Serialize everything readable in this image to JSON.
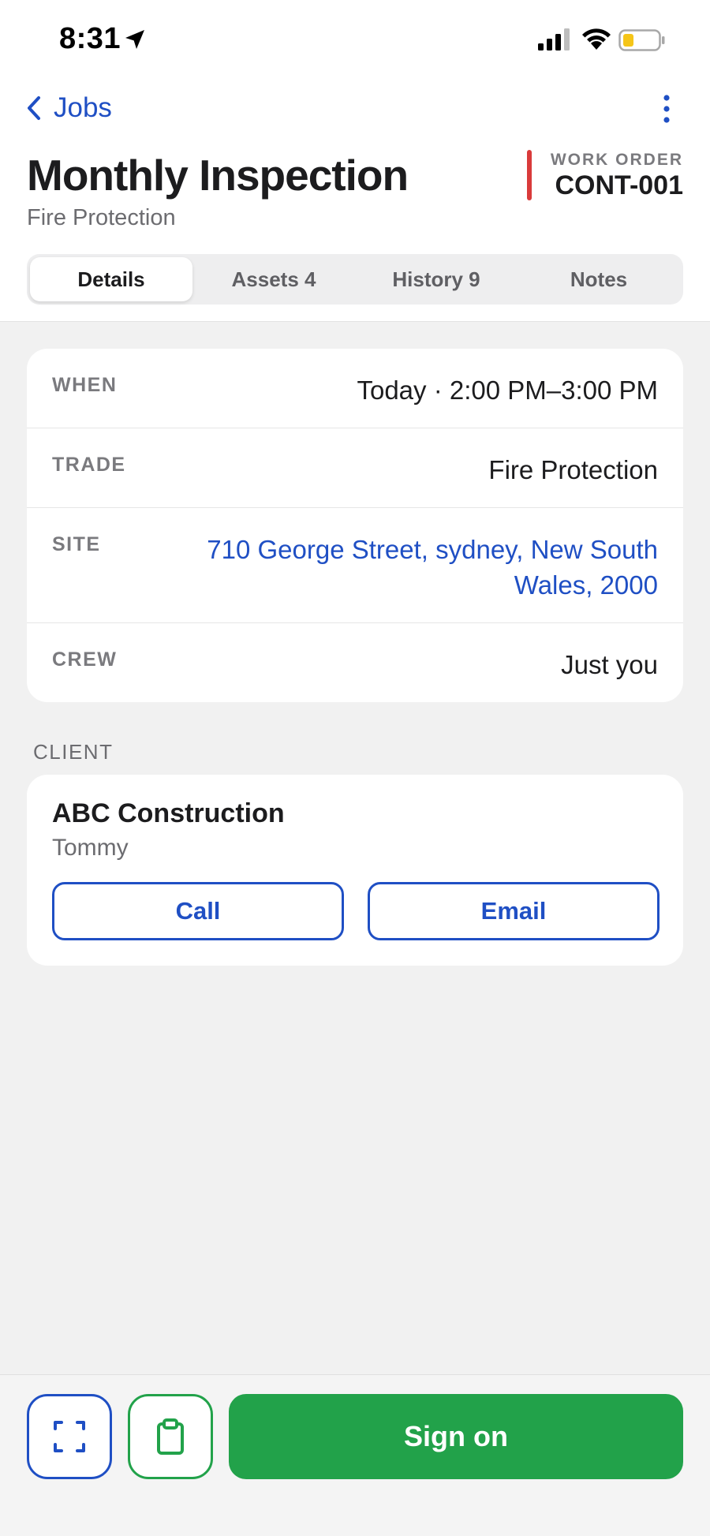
{
  "status_bar": {
    "time": "8:31",
    "icons": [
      "location-arrow-icon",
      "signal-icon",
      "wifi-icon",
      "battery-icon"
    ]
  },
  "nav": {
    "back_label": "Jobs",
    "more_icon": "more-vertical-icon"
  },
  "header": {
    "title": "Monthly Inspection",
    "subtitle": "Fire Protection",
    "work_order_label": "WORK ORDER",
    "work_order_value": "CONT-001"
  },
  "tabs": [
    {
      "label": "Details",
      "active": true
    },
    {
      "label": "Assets 4",
      "active": false
    },
    {
      "label": "History 9",
      "active": false
    },
    {
      "label": "Notes",
      "active": false
    }
  ],
  "details": [
    {
      "label": "WHEN",
      "value": "Today · 2:00 PM–3:00 PM"
    },
    {
      "label": "TRADE",
      "value": "Fire Protection"
    },
    {
      "label": "SITE",
      "value": "710 George Street, sydney, New South Wales, 2000"
    },
    {
      "label": "CREW",
      "value": "Just you"
    }
  ],
  "client": {
    "section_label": "CLIENT",
    "name": "ABC Construction",
    "contact": "Tommy",
    "call_label": "Call",
    "email_label": "Email"
  },
  "bottom_bar": {
    "scan_icon": "scan-icon",
    "clipboard_icon": "clipboard-icon",
    "primary_label": "Sign on"
  },
  "colors": {
    "accent_blue": "#1f4fc4",
    "accent_green": "#22a24a",
    "work_order_red": "#d93a3a"
  }
}
